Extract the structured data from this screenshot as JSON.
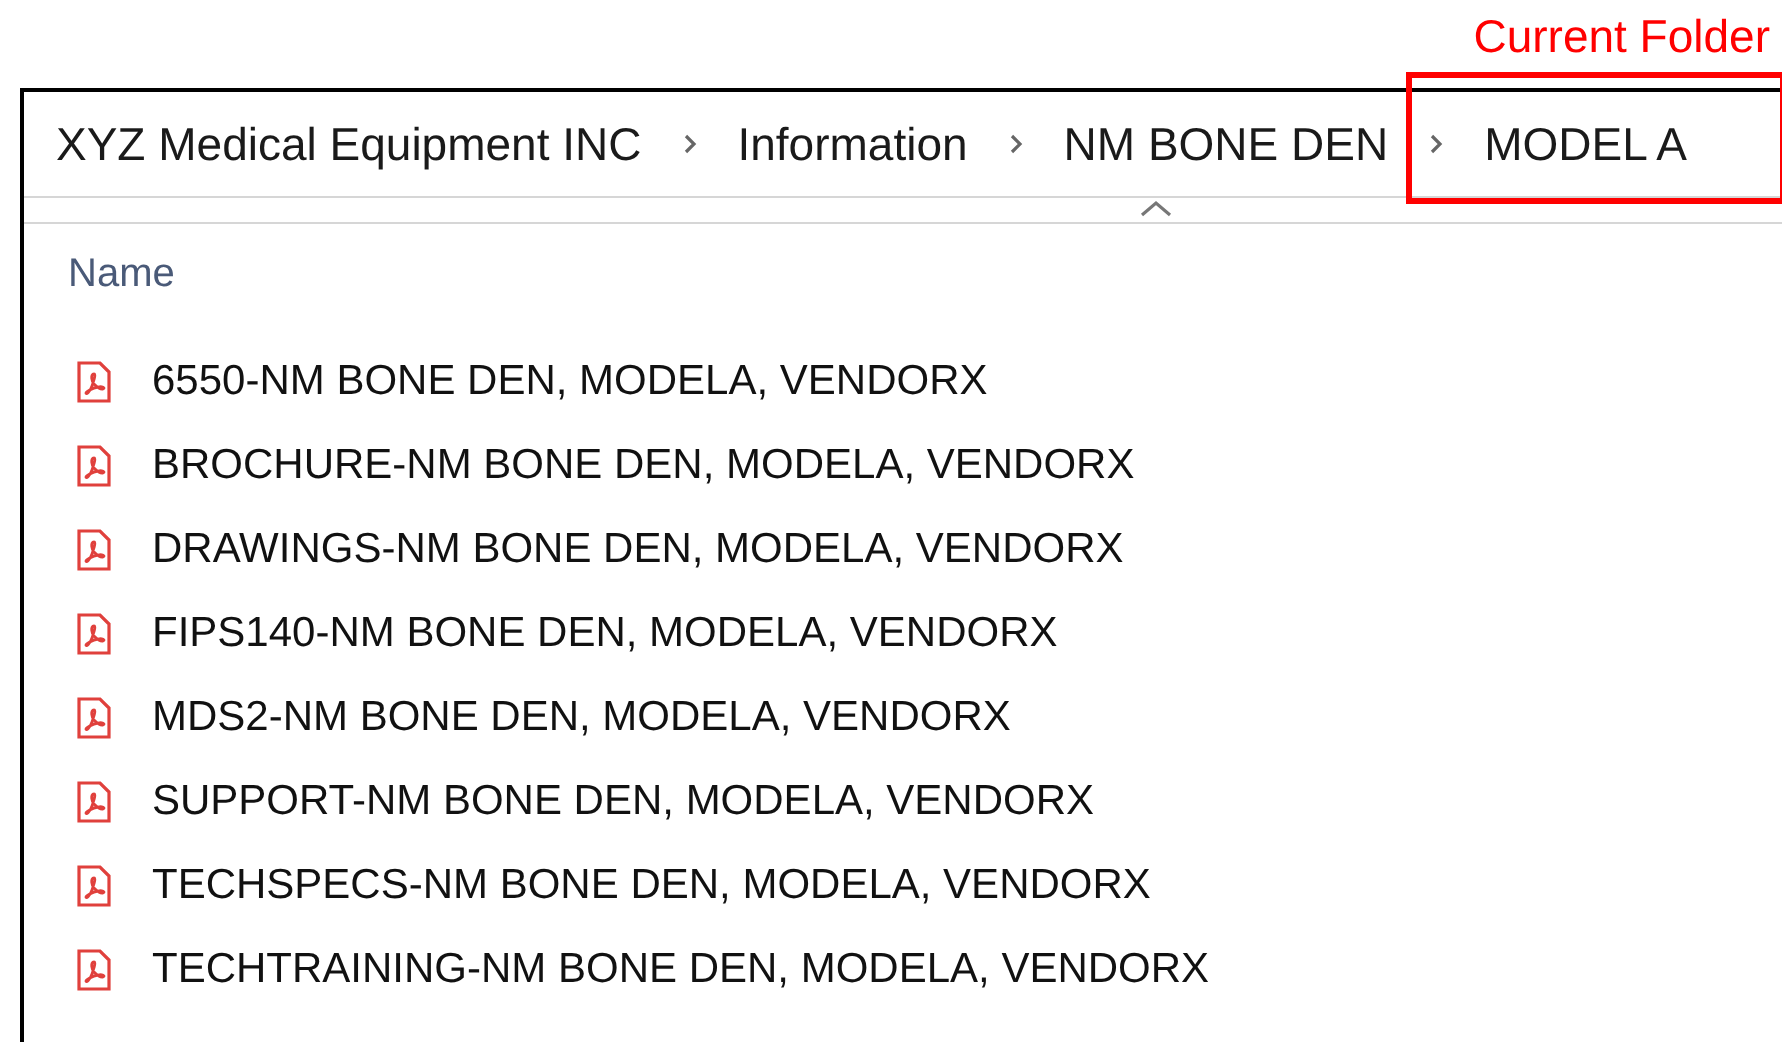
{
  "annotation": {
    "label": "Current Folder"
  },
  "breadcrumb": [
    {
      "label": "XYZ Medical Equipment INC"
    },
    {
      "label": "Information"
    },
    {
      "label": "NM BONE DEN"
    },
    {
      "label": "MODEL A"
    }
  ],
  "column_header": {
    "label": "Name"
  },
  "files": [
    {
      "name": "6550-NM BONE DEN, MODELA, VENDORX"
    },
    {
      "name": "BROCHURE-NM BONE DEN, MODELA, VENDORX"
    },
    {
      "name": "DRAWINGS-NM BONE DEN, MODELA, VENDORX"
    },
    {
      "name": "FIPS140-NM BONE DEN, MODELA, VENDORX"
    },
    {
      "name": "MDS2-NM BONE DEN, MODELA, VENDORX"
    },
    {
      "name": "SUPPORT-NM BONE DEN, MODELA, VENDORX"
    },
    {
      "name": "TECHSPECS-NM BONE DEN, MODELA, VENDORX"
    },
    {
      "name": "TECHTRAINING-NM BONE DEN, MODELA, VENDORX"
    }
  ]
}
